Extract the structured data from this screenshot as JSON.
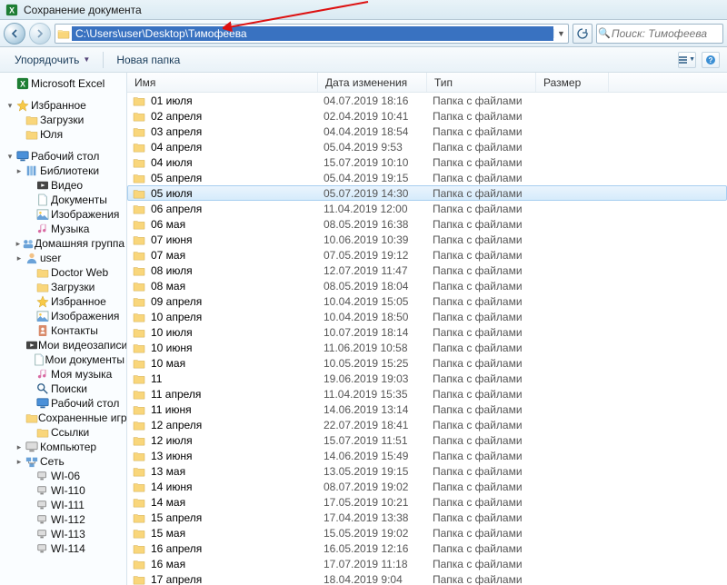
{
  "window": {
    "title": "Сохранение документа"
  },
  "nav": {
    "path": "C:\\Users\\user\\Desktop\\Тимофеева",
    "search_placeholder": "Поиск: Тимофеева"
  },
  "toolbar": {
    "organize": "Упорядочить",
    "new_folder": "Новая папка"
  },
  "columns": {
    "name": "Имя",
    "date": "Дата изменения",
    "type": "Тип",
    "size": "Размер"
  },
  "sidebar": [
    {
      "label": "Microsoft Excel",
      "icon": "excel",
      "level": 0
    },
    {
      "spacer": true
    },
    {
      "label": "Избранное",
      "icon": "fav",
      "level": 0,
      "exp": "▾"
    },
    {
      "label": "Загрузки",
      "icon": "dl",
      "level": 1
    },
    {
      "label": "Юля",
      "icon": "folder",
      "level": 1
    },
    {
      "spacer": true
    },
    {
      "label": "Рабочий стол",
      "icon": "desktop",
      "level": 0,
      "exp": "▾"
    },
    {
      "label": "Библиотеки",
      "icon": "lib",
      "level": 1,
      "exp": "▸"
    },
    {
      "label": "Видео",
      "icon": "video",
      "level": 2
    },
    {
      "label": "Документы",
      "icon": "doc",
      "level": 2
    },
    {
      "label": "Изображения",
      "icon": "img",
      "level": 2
    },
    {
      "label": "Музыка",
      "icon": "music",
      "level": 2
    },
    {
      "label": "Домашняя группа",
      "icon": "home",
      "level": 1,
      "exp": "▸"
    },
    {
      "label": "user",
      "icon": "user",
      "level": 1,
      "exp": "▸"
    },
    {
      "label": "Doctor Web",
      "icon": "folder",
      "level": 2
    },
    {
      "label": "Загрузки",
      "icon": "dl",
      "level": 2
    },
    {
      "label": "Избранное",
      "icon": "fav",
      "level": 2
    },
    {
      "label": "Изображения",
      "icon": "img",
      "level": 2
    },
    {
      "label": "Контакты",
      "icon": "contacts",
      "level": 2
    },
    {
      "label": "Мои видеозаписи",
      "icon": "video",
      "level": 2
    },
    {
      "label": "Мои документы",
      "icon": "doc",
      "level": 2
    },
    {
      "label": "Моя музыка",
      "icon": "music",
      "level": 2
    },
    {
      "label": "Поиски",
      "icon": "search",
      "level": 2
    },
    {
      "label": "Рабочий стол",
      "icon": "desktop",
      "level": 2
    },
    {
      "label": "Сохраненные игры",
      "icon": "games",
      "level": 2
    },
    {
      "label": "Ссылки",
      "icon": "links",
      "level": 2
    },
    {
      "label": "Компьютер",
      "icon": "pc",
      "level": 1,
      "exp": "▸"
    },
    {
      "label": "Сеть",
      "icon": "net",
      "level": 1,
      "exp": "▸"
    },
    {
      "label": "WI-06",
      "icon": "netpc",
      "level": 2
    },
    {
      "label": "WI-110",
      "icon": "netpc",
      "level": 2
    },
    {
      "label": "WI-111",
      "icon": "netpc",
      "level": 2
    },
    {
      "label": "WI-112",
      "icon": "netpc",
      "level": 2
    },
    {
      "label": "WI-113",
      "icon": "netpc",
      "level": 2
    },
    {
      "label": "WI-114",
      "icon": "netpc",
      "level": 2
    }
  ],
  "files": [
    {
      "name": "01 июля",
      "date": "04.07.2019 18:16",
      "type": "Папка с файлами"
    },
    {
      "name": "02 апреля",
      "date": "02.04.2019 10:41",
      "type": "Папка с файлами"
    },
    {
      "name": "03 апреля",
      "date": "04.04.2019 18:54",
      "type": "Папка с файлами"
    },
    {
      "name": "04 апреля",
      "date": "05.04.2019 9:53",
      "type": "Папка с файлами"
    },
    {
      "name": "04 июля",
      "date": "15.07.2019 10:10",
      "type": "Папка с файлами"
    },
    {
      "name": "05 апреля",
      "date": "05.04.2019 19:15",
      "type": "Папка с файлами"
    },
    {
      "name": "05 июля",
      "date": "05.07.2019 14:30",
      "type": "Папка с файлами",
      "selected": true
    },
    {
      "name": "06 апреля",
      "date": "11.04.2019 12:00",
      "type": "Папка с файлами"
    },
    {
      "name": "06 мая",
      "date": "08.05.2019 16:38",
      "type": "Папка с файлами"
    },
    {
      "name": "07 июня",
      "date": "10.06.2019 10:39",
      "type": "Папка с файлами"
    },
    {
      "name": "07 мая",
      "date": "07.05.2019 19:12",
      "type": "Папка с файлами"
    },
    {
      "name": "08 июля",
      "date": "12.07.2019 11:47",
      "type": "Папка с файлами"
    },
    {
      "name": "08 мая",
      "date": "08.05.2019 18:04",
      "type": "Папка с файлами"
    },
    {
      "name": "09 апреля",
      "date": "10.04.2019 15:05",
      "type": "Папка с файлами"
    },
    {
      "name": "10 апреля",
      "date": "10.04.2019 18:50",
      "type": "Папка с файлами"
    },
    {
      "name": "10 июля",
      "date": "10.07.2019 18:14",
      "type": "Папка с файлами"
    },
    {
      "name": "10 июня",
      "date": "11.06.2019 10:58",
      "type": "Папка с файлами"
    },
    {
      "name": "10 мая",
      "date": "10.05.2019 15:25",
      "type": "Папка с файлами"
    },
    {
      "name": "11",
      "date": "19.06.2019 19:03",
      "type": "Папка с файлами"
    },
    {
      "name": "11 апреля",
      "date": "11.04.2019 15:35",
      "type": "Папка с файлами"
    },
    {
      "name": "11 июня",
      "date": "14.06.2019 13:14",
      "type": "Папка с файлами"
    },
    {
      "name": "12 апреля",
      "date": "22.07.2019 18:41",
      "type": "Папка с файлами"
    },
    {
      "name": "12 июля",
      "date": "15.07.2019 11:51",
      "type": "Папка с файлами"
    },
    {
      "name": "13 июня",
      "date": "14.06.2019 15:49",
      "type": "Папка с файлами"
    },
    {
      "name": "13 мая",
      "date": "13.05.2019 19:15",
      "type": "Папка с файлами"
    },
    {
      "name": "14 июня",
      "date": "08.07.2019 19:02",
      "type": "Папка с файлами"
    },
    {
      "name": "14 мая",
      "date": "17.05.2019 10:21",
      "type": "Папка с файлами"
    },
    {
      "name": "15 апреля",
      "date": "17.04.2019 13:38",
      "type": "Папка с файлами"
    },
    {
      "name": "15 мая",
      "date": "15.05.2019 19:02",
      "type": "Папка с файлами"
    },
    {
      "name": "16 апреля",
      "date": "16.05.2019 12:16",
      "type": "Папка с файлами"
    },
    {
      "name": "16 мая",
      "date": "17.07.2019 11:18",
      "type": "Папка с файлами"
    },
    {
      "name": "17 апреля",
      "date": "18.04.2019 9:04",
      "type": "Папка с файлами"
    }
  ]
}
